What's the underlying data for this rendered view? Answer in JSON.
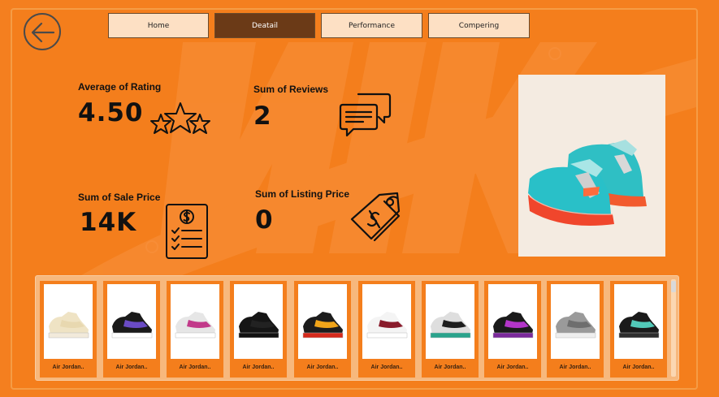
{
  "nav": {
    "tabs": [
      {
        "label": "Home",
        "active": false
      },
      {
        "label": "Deatail",
        "active": true
      },
      {
        "label": "Performance",
        "active": false
      },
      {
        "label": "Compering",
        "active": false
      }
    ]
  },
  "kpis": {
    "rating": {
      "label": "Average of Rating",
      "value": "4.50",
      "icon": "stars-icon"
    },
    "reviews": {
      "label": "Sum of Reviews",
      "value": "2",
      "icon": "chat-bubbles-icon"
    },
    "sale_price": {
      "label": "Sum of Sale Price",
      "value": "14K",
      "icon": "invoice-icon"
    },
    "listing_price": {
      "label": "Sum of Listing Price",
      "value": "0",
      "icon": "price-tag-icon"
    }
  },
  "gallery": {
    "items": [
      {
        "name": "Air Jordan..",
        "upper": "#efe3c4",
        "accent": "#e8d8b0",
        "sole": "#f2eadb"
      },
      {
        "name": "Air Jordan..",
        "upper": "#1a1a1a",
        "accent": "#6a4bc4",
        "sole": "#ffffff"
      },
      {
        "name": "Air Jordan..",
        "upper": "#e6e6e6",
        "accent": "#c23a8a",
        "sole": "#ffffff"
      },
      {
        "name": "Air Jordan..",
        "upper": "#151515",
        "accent": "#222222",
        "sole": "#111111"
      },
      {
        "name": "Air Jordan..",
        "upper": "#1c1c1c",
        "accent": "#f0a419",
        "sole": "#d42a1c"
      },
      {
        "name": "Air Jordan..",
        "upper": "#f4f4f4",
        "accent": "#8a1c2c",
        "sole": "#ffffff"
      },
      {
        "name": "Air Jordan..",
        "upper": "#dedede",
        "accent": "#1e1e1e",
        "sole": "#2aa38c"
      },
      {
        "name": "Air Jordan..",
        "upper": "#1a1a1a",
        "accent": "#b335c9",
        "sole": "#7a2a9a"
      },
      {
        "name": "Air Jordan..",
        "upper": "#9a9a9a",
        "accent": "#6e6e6e",
        "sole": "#eeeeee"
      },
      {
        "name": "Air Jordan..",
        "upper": "#1a1a1a",
        "accent": "#52c9b8",
        "sole": "#2d2d2d"
      }
    ]
  },
  "colors": {
    "background": "#f47e1c",
    "nav_active": "#6b3a17",
    "nav_inactive": "#fde0c4"
  }
}
